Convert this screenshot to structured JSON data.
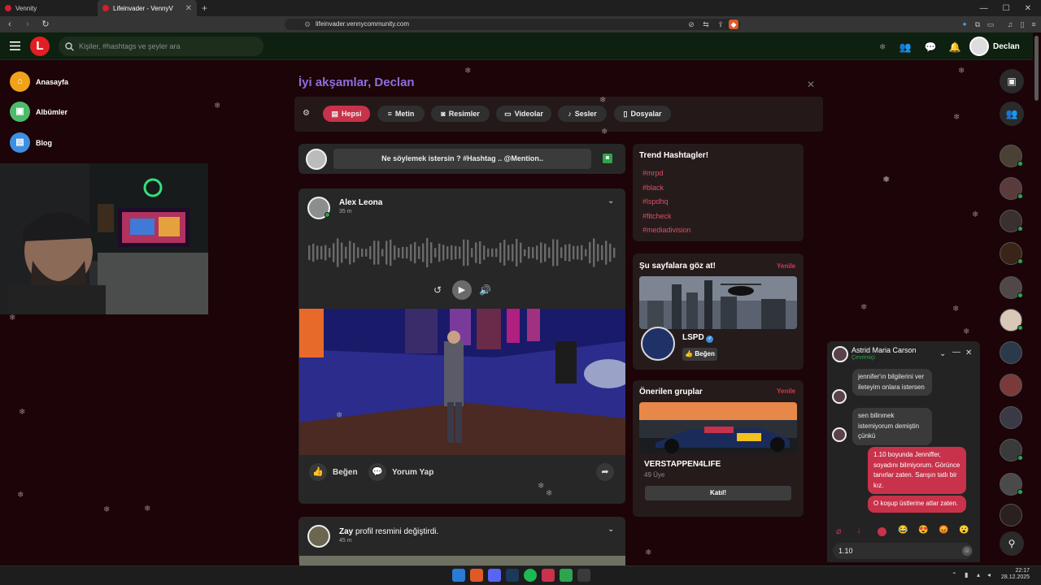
{
  "browser": {
    "tabs": [
      {
        "title": "Vennity",
        "active": false
      },
      {
        "title": "Lifeinvader - VennyV",
        "active": true
      }
    ],
    "url": "lifeinvader.vennycommunity.com"
  },
  "header": {
    "logo_letter": "L",
    "search_placeholder": "Kişiler, #hashtags ve şeyler ara",
    "user_name": "Declan"
  },
  "sidebar": {
    "items": [
      {
        "label": "Anasayfa",
        "icon": "home-icon",
        "color": "#f0a21b"
      },
      {
        "label": "Albümler",
        "icon": "album-icon",
        "color": "#4dbb6a"
      },
      {
        "label": "Blog",
        "icon": "blog-icon",
        "color": "#3d8fe0"
      }
    ]
  },
  "greeting": "İyi akşamlar, Declan",
  "filters": [
    "Hepsi",
    "Metin",
    "Resimler",
    "Videolar",
    "Sesler",
    "Dosyalar"
  ],
  "active_filter": "Hepsi",
  "composer_prompt": "Ne söylemek istersin ? #Hashtag .. @Mention..",
  "post": {
    "author": "Alex Leona",
    "time": "35 m",
    "like_label": "Beğen",
    "comment_label": "Yorum Yap"
  },
  "post2": {
    "author": "Zay",
    "action": " profil resmini değiştirdi.",
    "time": "45 m"
  },
  "trending": {
    "title": "Trend Hashtagler!",
    "tags": [
      "#mrpd",
      "#black",
      "#lspdhq",
      "#fitcheck",
      "#mediadivision"
    ]
  },
  "pages": {
    "title": "Şu sayfalara göz at!",
    "refresh": "Yenile",
    "page_name": "LSPD",
    "like_label": "Beğen"
  },
  "groups": {
    "title": "Önerilen gruplar",
    "refresh": "Yenile",
    "group_name": "VERSTAPPEN4LIFE",
    "members": "49 Üye",
    "join_label": "Katıl!"
  },
  "chat": {
    "name": "Astrid Maria Carson",
    "status": "Çevrimiçi",
    "messages": [
      {
        "from": "them",
        "text": "jennifer'ın bilgilerini ver ileteyim onlara istersen"
      },
      {
        "from": "them",
        "text": "sen bilinmek istemiyorum demiştin çünkü"
      },
      {
        "from": "me",
        "text": "1.10 boyunda Jenniffer, soyadını bilmiyorum. Görünce tanırlar zaten. Sarışın tatlı bir kız."
      },
      {
        "from": "me",
        "text": "O koşup üstlerine atlar zaten."
      }
    ],
    "input_value": "1.10"
  },
  "taskbar": {
    "time": "22:17",
    "date": "28.12.2025"
  },
  "colors": {
    "accent": "#c8324a",
    "header_bg": "#0e200f",
    "page_bg": "#1c0408",
    "online": "#2ea44f"
  }
}
